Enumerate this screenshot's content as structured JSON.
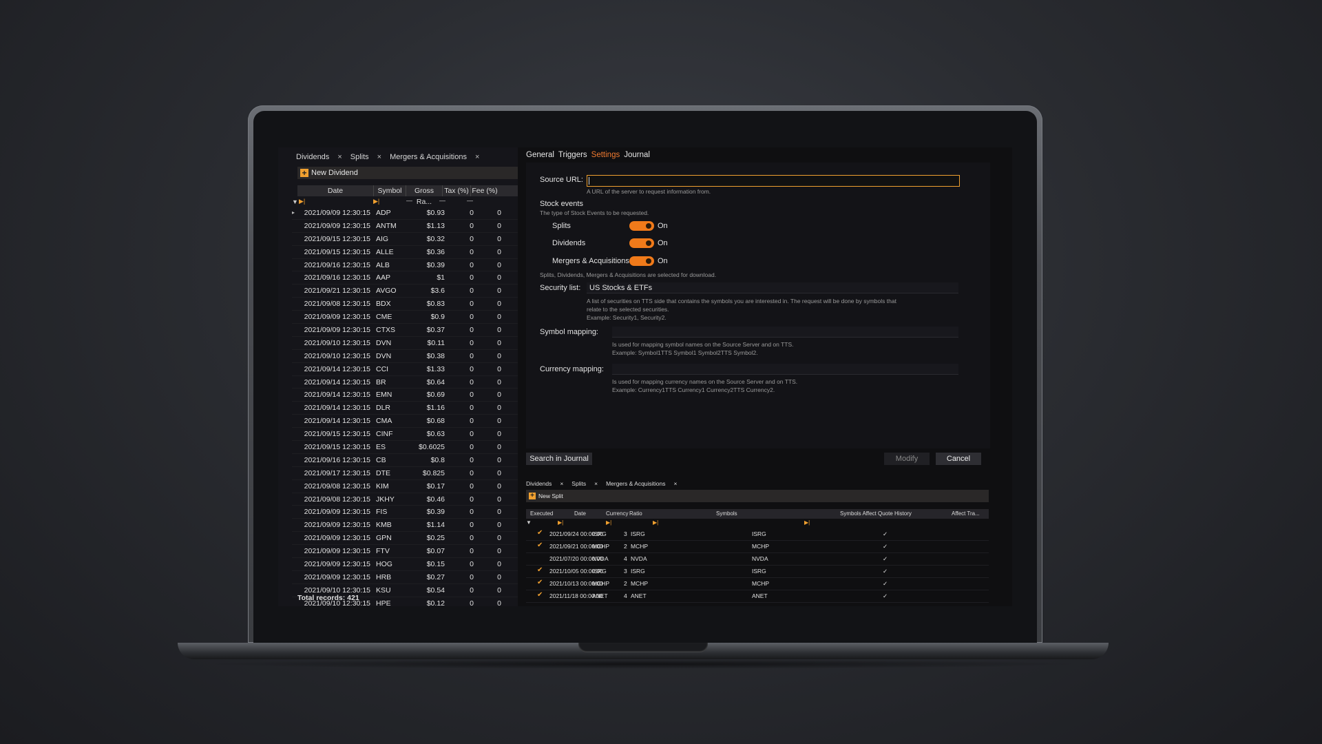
{
  "left_panel": {
    "tabs": [
      {
        "label": "Dividends",
        "close": "×"
      },
      {
        "label": "Splits",
        "close": "×"
      },
      {
        "label": "Mergers & Acquisitions",
        "close": "×"
      }
    ],
    "new_button": "New Dividend",
    "columns": [
      "Date",
      "Symbol",
      "Gross Ra...",
      "Tax (%)",
      "Fee (%)"
    ],
    "rows": [
      [
        "2021/09/09 12:30:15",
        "ADP",
        "$0.93",
        "0",
        "0"
      ],
      [
        "2021/09/09 12:30:15",
        "ANTM",
        "$1.13",
        "0",
        "0"
      ],
      [
        "2021/09/15 12:30:15",
        "AIG",
        "$0.32",
        "0",
        "0"
      ],
      [
        "2021/09/15 12:30:15",
        "ALLE",
        "$0.36",
        "0",
        "0"
      ],
      [
        "2021/09/16 12:30:15",
        "ALB",
        "$0.39",
        "0",
        "0"
      ],
      [
        "2021/09/16 12:30:15",
        "AAP",
        "$1",
        "0",
        "0"
      ],
      [
        "2021/09/21 12:30:15",
        "AVGO",
        "$3.6",
        "0",
        "0"
      ],
      [
        "2021/09/08 12:30:15",
        "BDX",
        "$0.83",
        "0",
        "0"
      ],
      [
        "2021/09/09 12:30:15",
        "CME",
        "$0.9",
        "0",
        "0"
      ],
      [
        "2021/09/09 12:30:15",
        "CTXS",
        "$0.37",
        "0",
        "0"
      ],
      [
        "2021/09/10 12:30:15",
        "DVN",
        "$0.11",
        "0",
        "0"
      ],
      [
        "2021/09/10 12:30:15",
        "DVN",
        "$0.38",
        "0",
        "0"
      ],
      [
        "2021/09/14 12:30:15",
        "CCI",
        "$1.33",
        "0",
        "0"
      ],
      [
        "2021/09/14 12:30:15",
        "BR",
        "$0.64",
        "0",
        "0"
      ],
      [
        "2021/09/14 12:30:15",
        "EMN",
        "$0.69",
        "0",
        "0"
      ],
      [
        "2021/09/14 12:30:15",
        "DLR",
        "$1.16",
        "0",
        "0"
      ],
      [
        "2021/09/14 12:30:15",
        "CMA",
        "$0.68",
        "0",
        "0"
      ],
      [
        "2021/09/15 12:30:15",
        "CINF",
        "$0.63",
        "0",
        "0"
      ],
      [
        "2021/09/15 12:30:15",
        "ES",
        "$0.6025",
        "0",
        "0"
      ],
      [
        "2021/09/16 12:30:15",
        "CB",
        "$0.8",
        "0",
        "0"
      ],
      [
        "2021/09/17 12:30:15",
        "DTE",
        "$0.825",
        "0",
        "0"
      ],
      [
        "2021/09/08 12:30:15",
        "KIM",
        "$0.17",
        "0",
        "0"
      ],
      [
        "2021/09/08 12:30:15",
        "JKHY",
        "$0.46",
        "0",
        "0"
      ],
      [
        "2021/09/09 12:30:15",
        "FIS",
        "$0.39",
        "0",
        "0"
      ],
      [
        "2021/09/09 12:30:15",
        "KMB",
        "$1.14",
        "0",
        "0"
      ],
      [
        "2021/09/09 12:30:15",
        "GPN",
        "$0.25",
        "0",
        "0"
      ],
      [
        "2021/09/09 12:30:15",
        "FTV",
        "$0.07",
        "0",
        "0"
      ],
      [
        "2021/09/09 12:30:15",
        "HOG",
        "$0.15",
        "0",
        "0"
      ],
      [
        "2021/09/09 12:30:15",
        "HRB",
        "$0.27",
        "0",
        "0"
      ],
      [
        "2021/09/10 12:30:15",
        "KSU",
        "$0.54",
        "0",
        "0"
      ],
      [
        "2021/09/10 12:30:15",
        "HPE",
        "$0.12",
        "0",
        "0"
      ]
    ],
    "total": "Total records: 421"
  },
  "right_panel": {
    "tabs": [
      "General",
      "Triggers",
      "Settings",
      "Journal"
    ],
    "active_tab": "Settings",
    "source_url_label": "Source URL:",
    "source_url_hint": "A URL of the server to request information from.",
    "stock_events_label": "Stock events",
    "stock_events_hint": "The type of Stock Events to be requested.",
    "events": [
      {
        "label": "Splits",
        "state": "On"
      },
      {
        "label": "Dividends",
        "state": "On"
      },
      {
        "label": "Mergers & Acquisitions",
        "state": "On"
      }
    ],
    "events_note": "Splits, Dividends, Mergers & Acquisitions are selected for download.",
    "security_list_label": "Security list:",
    "security_list_value": "US Stocks & ETFs",
    "security_hint_1": "A list of securities on TTS side that contains the symbols you are interested in. The request will be done by symbols that",
    "security_hint_2": "relate to the selected securities.",
    "security_hint_3": "Example: Security1, Security2.",
    "symbol_mapping_label": "Symbol mapping:",
    "symbol_hint_1": "Is used for mapping symbol names on the Source Server and on TTS.",
    "symbol_hint_2": "Example: Symbol1TTS Symbol1 Symbol2TTS Symbol2.",
    "currency_mapping_label": "Currency mapping:",
    "currency_hint_1": "Is used for mapping currency names on the Source Server and on TTS.",
    "currency_hint_2": "Example: Currency1TTS Currency1 Currency2TTS Currency2.",
    "search_button": "Search in Journal",
    "modify_button": "Modify",
    "cancel_button": "Cancel"
  },
  "bottom_grid": {
    "tabs": [
      "Dividends",
      "×",
      "Splits",
      "×",
      "Mergers & Acquisitions",
      "×"
    ],
    "new_button": "New Split",
    "columns": [
      "Executed",
      "Date",
      "Currency",
      "Ratio",
      "Symbols",
      "Symbols Affect Quote History",
      "Affect Tra..."
    ],
    "rows": [
      {
        "executed": "✔",
        "date": "2021/09/24 00:00:00",
        "currency": "ISRG",
        "ratio": "3",
        "symbols": "ISRG",
        "affect": "ISRG",
        "tra": "✓"
      },
      {
        "executed": "✔",
        "date": "2021/09/21 00:00:00",
        "currency": "MCHP",
        "ratio": "2",
        "symbols": "MCHP",
        "affect": "MCHP",
        "tra": "✓"
      },
      {
        "executed": "",
        "date": "2021/07/20 00:00:00",
        "currency": "NVDA",
        "ratio": "4",
        "symbols": "NVDA",
        "affect": "NVDA",
        "tra": "✓"
      },
      {
        "executed": "✔",
        "date": "2021/10/05 00:00:00",
        "currency": "ISRG",
        "ratio": "3",
        "symbols": "ISRG",
        "affect": "ISRG",
        "tra": "✓"
      },
      {
        "executed": "✔",
        "date": "2021/10/13 00:00:00",
        "currency": "MCHP",
        "ratio": "2",
        "symbols": "MCHP",
        "affect": "MCHP",
        "tra": "✓"
      },
      {
        "executed": "✔",
        "date": "2021/11/18 00:00:00",
        "currency": "ANET",
        "ratio": "4",
        "symbols": "ANET",
        "affect": "ANET",
        "tra": "✓"
      }
    ]
  },
  "colors": {
    "accent": "#f07a30",
    "toggle": "#f07a1a",
    "highlight": "#f0a030"
  }
}
